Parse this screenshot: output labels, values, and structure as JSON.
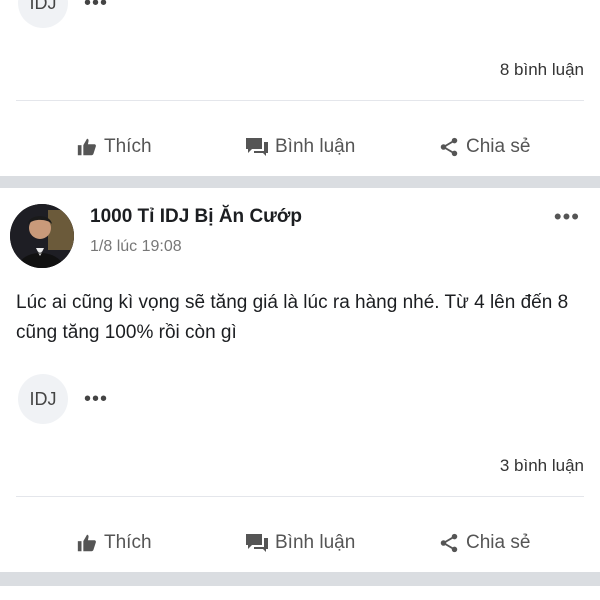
{
  "post_top": {
    "tag_label": "IDJ",
    "more_label": "•••",
    "comment_count": "8 bình luận",
    "actions": {
      "like": "Thích",
      "comment": "Bình luận",
      "share": "Chia sẻ"
    }
  },
  "post_main": {
    "author": "1000 Tỉ IDJ Bị Ăn Cướp",
    "timestamp": "1/8 lúc 19:08",
    "more_label": "•••",
    "text": "Lúc ai cũng kì vọng sẽ tăng giá là lúc ra hàng nhé. Từ 4 lên đến 8 cũng tăng 100% rồi còn gì",
    "tag_label": "IDJ",
    "tag_more_label": "•••",
    "comment_count": "3 bình luận",
    "actions": {
      "like": "Thích",
      "comment": "Bình luận",
      "share": "Chia sẻ"
    }
  },
  "colors": {
    "separator": "#dadde1",
    "action_text": "#555555"
  },
  "icons": {
    "like": "thumbs-up-icon",
    "comment": "comment-icon",
    "share": "share-icon",
    "more": "more-dots-icon"
  }
}
